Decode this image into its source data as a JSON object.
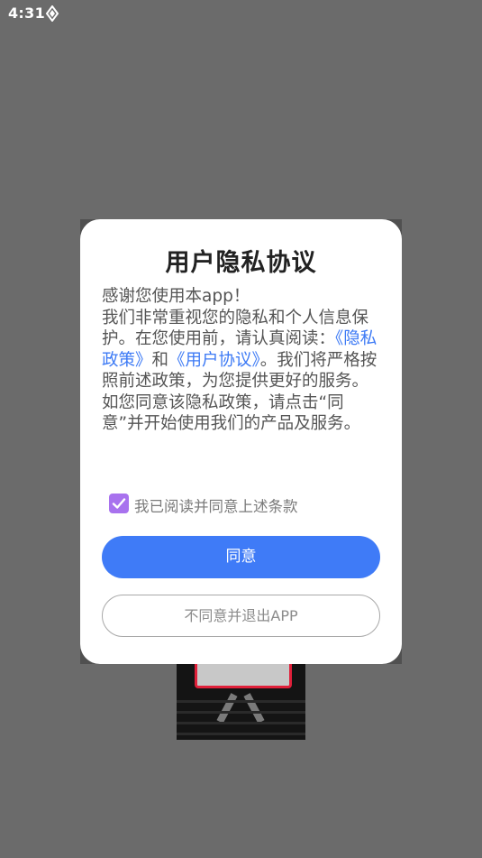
{
  "status_bar": {
    "time": "4:31",
    "icon": "app-notification-icon"
  },
  "dialog": {
    "title": "用户隐私协议",
    "body": {
      "greeting": "感谢您使用本app！",
      "text_1": "我们非常重视您的隐私和个人信息保护。在您使用前，请认真阅读：",
      "privacy_link": "《隐私政策》",
      "and": "和",
      "user_agreement_link": "《用户协议》",
      "text_2": "。我们将严格按照前述政策，为您提供更好的服务。如您同意该隐私政策，请点击“同意”并开始使用我们的产品及服务。"
    },
    "agree_checkbox": {
      "checked": true,
      "label": "我已阅读并同意上述条款"
    },
    "agree_button": "同意",
    "decline_button": "不同意并退出APP"
  },
  "colors": {
    "accent": "#3f7bf7",
    "link": "#3d7af5",
    "checkbox": "#a872ee",
    "overlay": "#6b6b6b"
  }
}
